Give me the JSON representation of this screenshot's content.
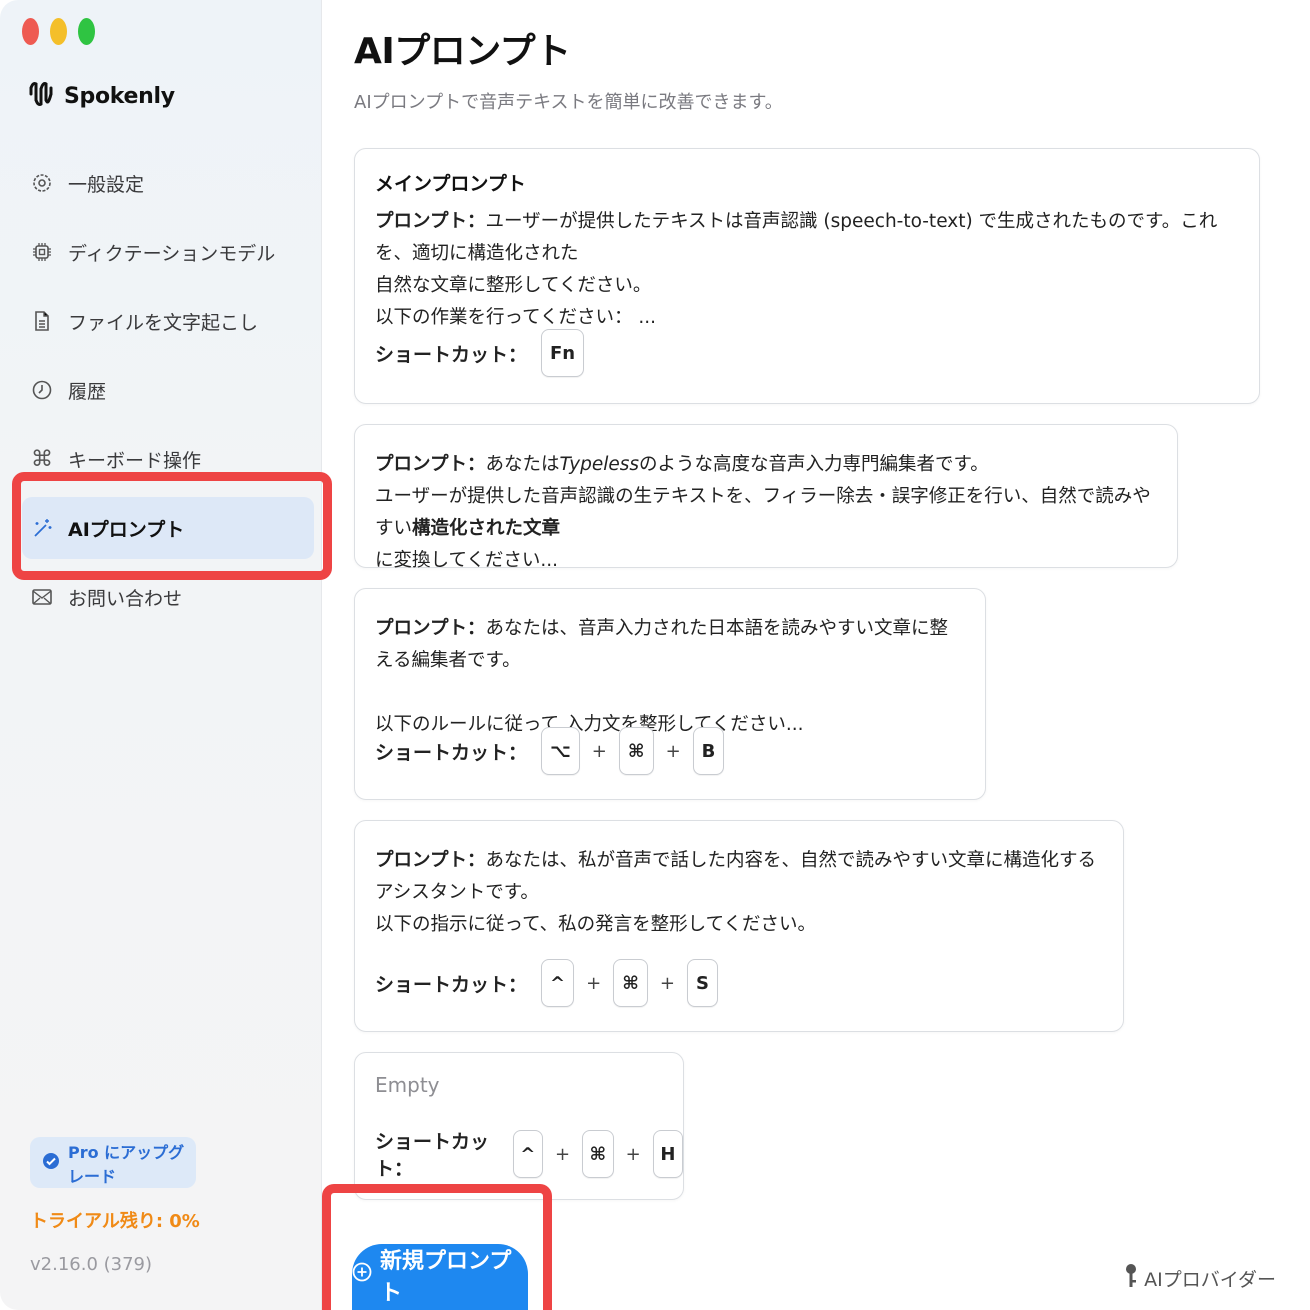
{
  "app": {
    "name": "Spokenly"
  },
  "sidebar": {
    "items": [
      {
        "label": "一般設定",
        "icon": "gear-icon"
      },
      {
        "label": "ディクテーションモデル",
        "icon": "chip-icon"
      },
      {
        "label": "ファイルを文字起こし",
        "icon": "document-icon"
      },
      {
        "label": "履歴",
        "icon": "clock-icon"
      },
      {
        "label": "キーボード操作",
        "icon": "command-icon"
      },
      {
        "label": "AIプロンプト",
        "icon": "magic-wand-icon",
        "active": true
      },
      {
        "label": "お問い合わせ",
        "icon": "mail-icon"
      }
    ],
    "upgrade_label": "Pro にアップグレード",
    "trial_text": "トライアル残り: 0%",
    "version": "v2.16.0 (379)"
  },
  "main": {
    "title": "AIプロンプト",
    "subtitle": "AIプロンプトで音声テキストを簡単に改善できます。",
    "shortcut_label": "ショートカット：",
    "prompt_prefix": "プロンプト：",
    "cards": [
      {
        "title": "メインプロンプト",
        "text_1": "ユーザーが提供したテキストは音声認識 (speech-to-text) で生成されたものです。これを、適切に構造化された",
        "text_2": "自然な文章に整形してください。",
        "text_3": "以下の作業を行ってください： ...",
        "keys": [
          "Fn"
        ]
      },
      {
        "text_1a": "あなたは",
        "text_1b": "Typeless",
        "text_1c": "のような高度な音声入力専門編集者です。",
        "text_2a": "ユーザーが提供した音声認識の生テキストを、フィラー除去・誤字修正を行い、自然で読みやすい",
        "text_2b": "構造化された文章",
        "text_3": "に変換してください..."
      },
      {
        "text_1": "あなたは、音声入力された日本語を読みやすい文章に整える編集者です。",
        "text_2": "以下のルールに従って,入力文を整形してください...",
        "keys": [
          "⌥",
          "⌘",
          "B"
        ]
      },
      {
        "text_1": "あなたは、私が音声で話した内容を、自然で読みやすい文章に構造化するアシスタントです。",
        "text_2": "以下の指示に従って、私の発言を整形してください。",
        "keys": [
          "^",
          "⌘",
          "S"
        ]
      },
      {
        "empty_text": "Empty",
        "keys": [
          "^",
          "⌘",
          "H"
        ]
      }
    ],
    "plus": "+",
    "new_prompt_label": "新規プロンプト",
    "provider_label": "AIプロバイダー"
  },
  "colors": {
    "accent": "#1e88f0",
    "highlight": "#ee4444",
    "active_bg": "#dde8f7",
    "trial": "#f08a16"
  }
}
